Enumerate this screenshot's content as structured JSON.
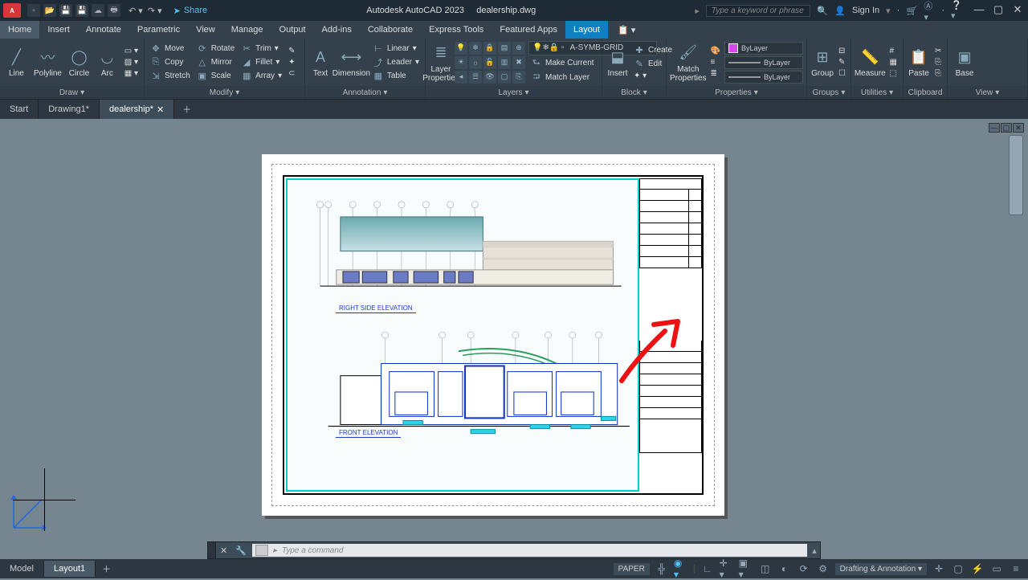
{
  "title": {
    "app": "Autodesk AutoCAD 2023",
    "file": "dealership.dwg"
  },
  "titlebar": {
    "share": "Share",
    "search_placeholder": "Type a keyword or phrase",
    "signin": "Sign In"
  },
  "menu": {
    "items": [
      "Home",
      "Insert",
      "Annotate",
      "Parametric",
      "View",
      "Manage",
      "Output",
      "Add-ins",
      "Collaborate",
      "Express Tools",
      "Featured Apps",
      "Layout"
    ]
  },
  "ribbon": {
    "draw": {
      "title": "Draw",
      "line": "Line",
      "polyline": "Polyline",
      "circle": "Circle",
      "arc": "Arc"
    },
    "modify": {
      "title": "Modify",
      "move": "Move",
      "rotate": "Rotate",
      "trim": "Trim",
      "copy": "Copy",
      "mirror": "Mirror",
      "fillet": "Fillet",
      "stretch": "Stretch",
      "scale": "Scale",
      "array": "Array"
    },
    "annot": {
      "title": "Annotation",
      "text": "Text",
      "dimension": "Dimension",
      "linear": "Linear",
      "leader": "Leader",
      "table": "Table"
    },
    "layers": {
      "title": "Layers",
      "props": "Layer\nProperties",
      "current_layer": "A-SYMB-GRID",
      "make_current": "Make Current",
      "match_layer": "Match Layer"
    },
    "block": {
      "title": "Block",
      "insert": "Insert",
      "create": "Create",
      "edit": "Edit"
    },
    "props": {
      "title": "Properties",
      "match": "Match\nProperties",
      "bylayer1": "ByLayer",
      "bylayer2": "ByLayer",
      "bylayer3": "ByLayer"
    },
    "groups": {
      "title": "Groups",
      "group": "Group"
    },
    "utilities": {
      "title": "Utilities",
      "measure": "Measure"
    },
    "clipboard": {
      "title": "Clipboard",
      "paste": "Paste"
    },
    "view": {
      "title": "View",
      "base": "Base"
    }
  },
  "filetabs": {
    "start": "Start",
    "drawing1": "Drawing1*",
    "dealership": "dealership*"
  },
  "drawing": {
    "right_elev": "RIGHT SIDE ELEVATION",
    "front_elev": "FRONT ELEVATION"
  },
  "cmdline": {
    "placeholder": "Type a command"
  },
  "bottom": {
    "model": "Model",
    "layout1": "Layout1",
    "paper": "PAPER",
    "workspace": "Drafting & Annotation"
  }
}
